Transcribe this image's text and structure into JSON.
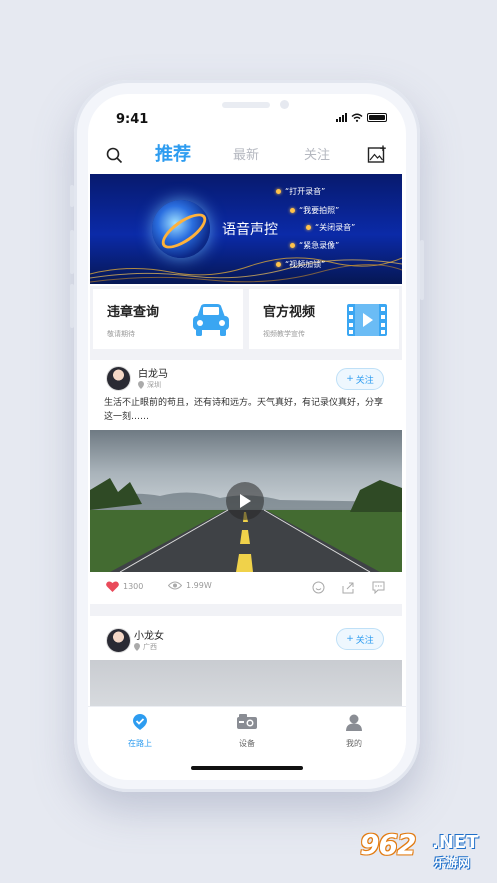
{
  "status_bar": {
    "time": "9:41"
  },
  "top_nav": {
    "tabs": [
      {
        "label": "推荐",
        "active": true
      },
      {
        "label": "最新",
        "active": false
      },
      {
        "label": "关注",
        "active": false
      }
    ],
    "search_icon": "search-icon",
    "post_icon": "image-add-icon"
  },
  "banner": {
    "title": "语音声控",
    "commands": [
      "“打开录音”",
      "“我要拍照”",
      "“关闭录音”",
      "“紧急录像”",
      "“视频加锁”"
    ]
  },
  "quick_cards": [
    {
      "title": "违章查询",
      "subtitle": "敬请期待",
      "icon": "car-icon"
    },
    {
      "title": "官方视频",
      "subtitle": "视频教学宣传",
      "icon": "video-film-icon"
    }
  ],
  "posts": [
    {
      "user": "白龙马",
      "location": "深圳",
      "follow_label": "关注",
      "text": "生活不止眼前的苟且，还有诗和远方。天气真好，有记录仪真好，分享这一刻……",
      "likes": "1300",
      "views": "1.99W"
    },
    {
      "user": "小龙女",
      "location": "广西",
      "follow_label": "关注"
    }
  ],
  "tab_bar": {
    "items": [
      {
        "label": "在路上",
        "icon": "location-check-icon",
        "active": true
      },
      {
        "label": "设备",
        "icon": "camera-device-icon",
        "active": false
      },
      {
        "label": "我的",
        "icon": "user-icon",
        "active": false
      }
    ]
  },
  "watermark": {
    "number": "962",
    "domain": ".NET",
    "text": "乐游网"
  },
  "colors": {
    "accent": "#2d9cf0",
    "banner_bg": "#0b2aa8",
    "like": "#e94a5a"
  }
}
